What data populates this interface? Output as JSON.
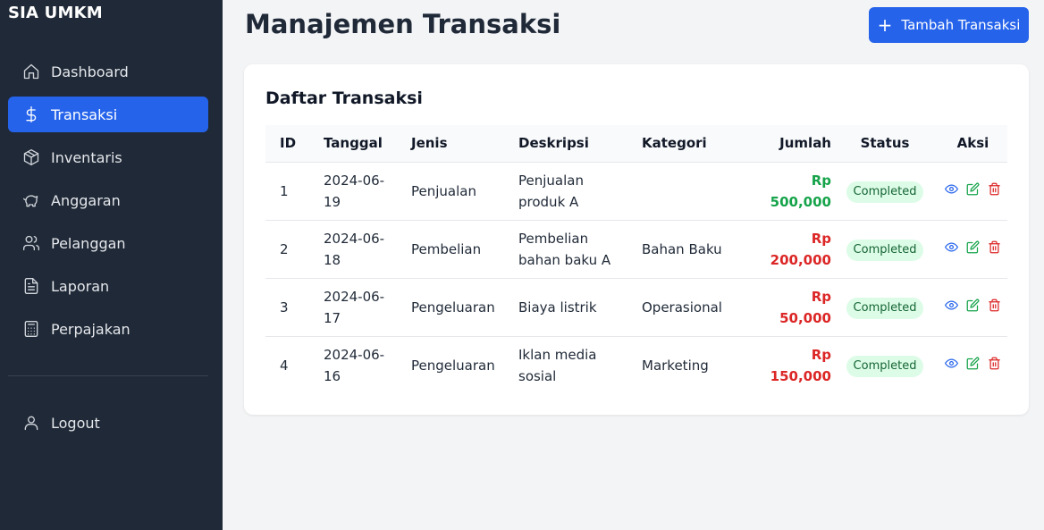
{
  "app": {
    "brand": "SIA UMKM"
  },
  "sidebar": {
    "items": [
      {
        "label": "Dashboard",
        "icon": "home-icon",
        "active": false
      },
      {
        "label": "Transaksi",
        "icon": "dollar-icon",
        "active": true
      },
      {
        "label": "Inventaris",
        "icon": "box-icon",
        "active": false
      },
      {
        "label": "Anggaran",
        "icon": "piggy-bank-icon",
        "active": false
      },
      {
        "label": "Pelanggan",
        "icon": "users-icon",
        "active": false
      },
      {
        "label": "Laporan",
        "icon": "document-icon",
        "active": false
      },
      {
        "label": "Perpajakan",
        "icon": "calculator-icon",
        "active": false
      }
    ],
    "logout": {
      "label": "Logout",
      "icon": "user-icon"
    }
  },
  "header": {
    "title": "Manajemen Transaksi",
    "add_button": "Tambah Transaksi"
  },
  "table": {
    "title": "Daftar Transaksi",
    "columns": [
      "ID",
      "Tanggal",
      "Jenis",
      "Deskripsi",
      "Kategori",
      "Jumlah",
      "Status",
      "Aksi"
    ],
    "rows": [
      {
        "id": "1",
        "date_a": "2024-06-",
        "date_b": "19",
        "jenis": "Penjualan",
        "desk_a": "Penjualan",
        "desk_b": "produk A",
        "kategori": "",
        "amount_a": "Rp",
        "amount_b": "500,000",
        "amount_color": "#16a34a",
        "status": "Completed"
      },
      {
        "id": "2",
        "date_a": "2024-06-",
        "date_b": "18",
        "jenis": "Pembelian",
        "desk_a": "Pembelian",
        "desk_b": "bahan baku A",
        "kategori": "Bahan Baku",
        "amount_a": "Rp",
        "amount_b": "200,000",
        "amount_color": "#dc2626",
        "status": "Completed"
      },
      {
        "id": "3",
        "date_a": "2024-06-",
        "date_b": "17",
        "jenis": "Pengeluaran",
        "desk_a": "Biaya listrik",
        "desk_b": "",
        "kategori": "Operasional",
        "amount_a": "Rp",
        "amount_b": "50,000",
        "amount_color": "#dc2626",
        "status": "Completed"
      },
      {
        "id": "4",
        "date_a": "2024-06-",
        "date_b": "16",
        "jenis": "Pengeluaran",
        "desk_a": "Iklan media",
        "desk_b": "sosial",
        "kategori": "Marketing",
        "amount_a": "Rp",
        "amount_b": "150,000",
        "amount_color": "#dc2626",
        "status": "Completed"
      }
    ]
  },
  "colors": {
    "sidebar_bg": "#1f2937",
    "accent": "#2563eb",
    "income": "#16a34a",
    "expense": "#dc2626",
    "badge_bg": "#dcfce7"
  }
}
